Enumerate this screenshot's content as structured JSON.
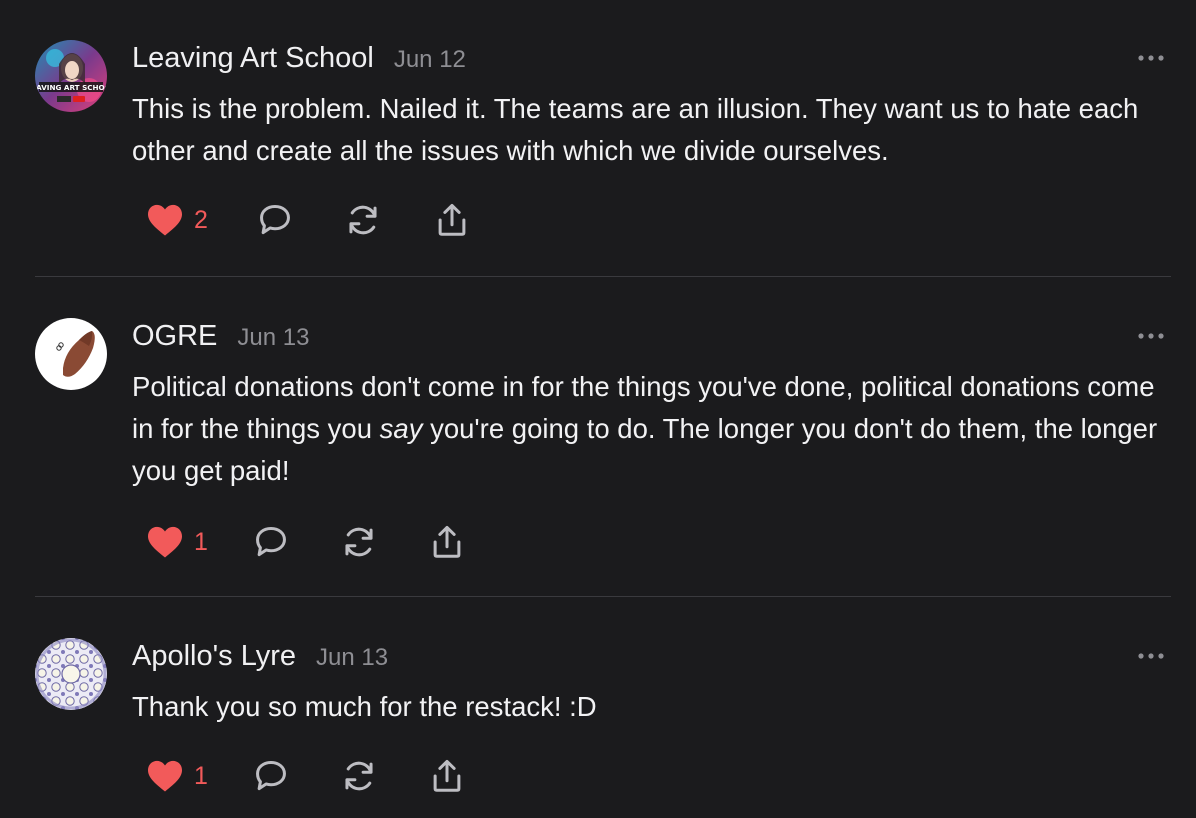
{
  "comments": [
    {
      "author": "Leaving Art School",
      "date": "Jun 12",
      "text_parts": [
        "This is the problem. Nailed it. The teams are an illusion. They want us to hate each other and create all the issues with which we divide ourselves."
      ],
      "likes": "2",
      "avatar_text": "LEAVING ART SCHOOL"
    },
    {
      "author": "OGRE",
      "date": "Jun 13",
      "text_parts": [
        "Political donations don't come in for the things you've done, political donations come in for the things you ",
        "say",
        " you're going to do. The longer you don't do them, the longer you get paid!"
      ],
      "likes": "1"
    },
    {
      "author": "Apollo's Lyre",
      "date": "Jun 13",
      "text_parts": [
        "Thank you so much for the restack! :D"
      ],
      "likes": "1"
    }
  ],
  "icons": {
    "like": "heart-icon",
    "comment": "speech-bubble-icon",
    "restack": "restack-arrows-icon",
    "share": "share-icon",
    "more": "more-dots-icon"
  },
  "colors": {
    "background": "#1b1b1d",
    "text": "#f2f2f4",
    "muted": "#8e8e93",
    "like": "#f25a5a",
    "icon": "#bdbdc2",
    "divider": "#3a3a3e"
  }
}
